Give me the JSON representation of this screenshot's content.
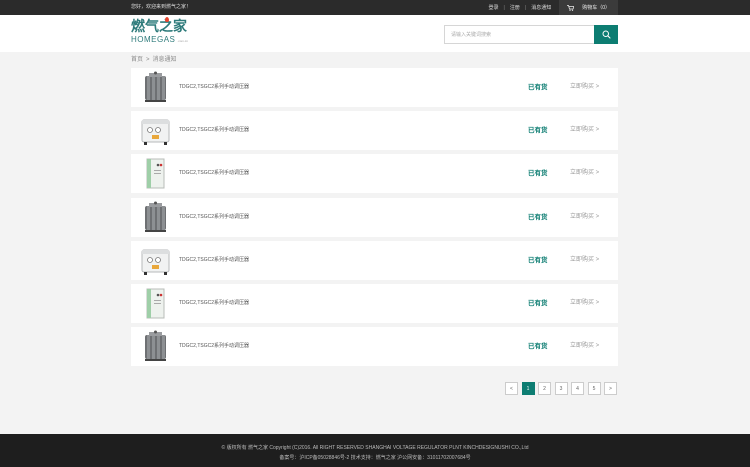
{
  "topbar": {
    "welcome": "您好，欢迎来到燃气之家！",
    "login": "登录",
    "register": "注册",
    "messages": "消息通知",
    "cart": "购物车（0）"
  },
  "logo": {
    "cn": "燃气之家",
    "en": "HOMEGAS",
    "domain": ".com.cn"
  },
  "search": {
    "placeholder": "请输入关键词搜索"
  },
  "breadcrumb": {
    "home": "首页",
    "separator": ">",
    "current": "消息通知"
  },
  "products": [
    {
      "name": "TDGC2,TSGC2系列手动调压器",
      "stock": "已有货",
      "buy": "立即购买 >"
    },
    {
      "name": "TDGC2,TSGC2系列手动调压器",
      "stock": "已有货",
      "buy": "立即购买 >"
    },
    {
      "name": "TDGC2,TSGC2系列手动调压器",
      "stock": "已有货",
      "buy": "立即购买 >"
    },
    {
      "name": "TDGC2,TSGC2系列手动调压器",
      "stock": "已有货",
      "buy": "立即购买 >"
    },
    {
      "name": "TDGC2,TSGC2系列手动调压器",
      "stock": "已有货",
      "buy": "立即购买 >"
    },
    {
      "name": "TDGC2,TSGC2系列手动调压器",
      "stock": "已有货",
      "buy": "立即购买 >"
    },
    {
      "name": "TDGC2,TSGC2系列手动调压器",
      "stock": "已有货",
      "buy": "立即购买 >"
    }
  ],
  "pagination": {
    "prev": "<",
    "pages": [
      "1",
      "2",
      "3",
      "4",
      "5"
    ],
    "next": ">",
    "active": "1"
  },
  "footer": {
    "line1": "© 版权所有 燃气之家 Copyright (C)2016. All RIGHT RESERVED SHANGHAI VOLTAGE REGULATOR PLNT KINCHDESIGNUSHI CO.,Ltd",
    "line2": "备案号：沪ICP备05028846号-2 技术支持：燃气之家 沪公网安备：31011702007684号"
  },
  "colors": {
    "accent": "#0d7d72",
    "topbar": "#2b2b2b",
    "footer": "#1e1e1e"
  }
}
